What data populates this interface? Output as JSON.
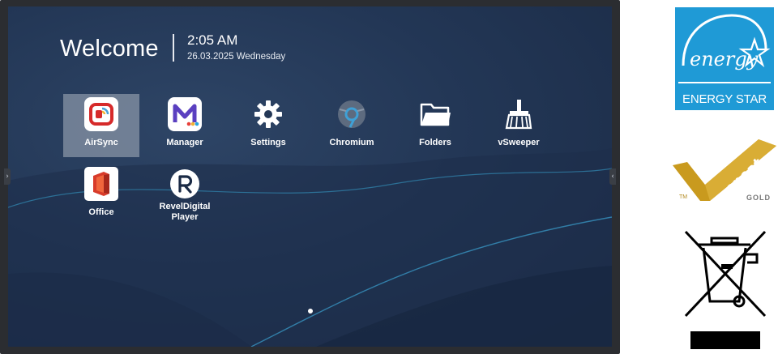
{
  "header": {
    "welcome": "Welcome",
    "time": "2:05 AM",
    "date": "26.03.2025 Wednesday"
  },
  "apps": [
    {
      "label": "AirSync",
      "icon": "airsync-icon",
      "selected": true
    },
    {
      "label": "Manager",
      "icon": "manager-icon"
    },
    {
      "label": "Settings",
      "icon": "gear-icon"
    },
    {
      "label": "Chromium",
      "icon": "chromium-icon"
    },
    {
      "label": "Folders",
      "icon": "folder-icon"
    },
    {
      "label": "vSweeper",
      "icon": "broom-icon"
    },
    {
      "label": "Office",
      "icon": "office-icon"
    },
    {
      "label": "RevelDigital Player",
      "label_line1": "RevelDigital",
      "label_line2": "Player",
      "icon": "reveldigital-icon"
    }
  ],
  "pager": {
    "current_page": 1,
    "total_pages": 1
  },
  "certifications": {
    "energy_star": "ENERGY STAR",
    "energy_script": "energy",
    "epeat_word": "epeat",
    "epeat_tier": "GOLD",
    "epeat_tm": "TM"
  },
  "colors": {
    "accent_energy_star": "#1f9ad6",
    "epeat_gold": "#c99a1e",
    "screen_bg": "#233756"
  }
}
